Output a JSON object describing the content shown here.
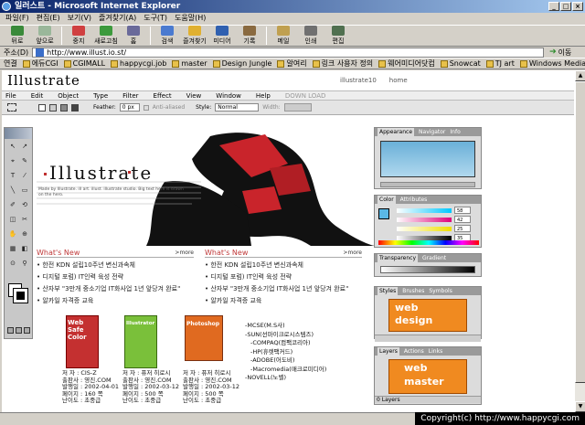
{
  "window": {
    "title": "일러스트 - Microsoft Internet Explorer"
  },
  "menu": [
    "파일(F)",
    "편집(E)",
    "보기(V)",
    "즐겨찾기(A)",
    "도구(T)",
    "도움말(H)"
  ],
  "toolbar": {
    "buttons": [
      {
        "label": "뒤로",
        "icon": "back-arrow-icon",
        "color": "#3a8a3a"
      },
      {
        "label": "앞으로",
        "icon": "forward-arrow-icon",
        "color": "#9ab79a"
      },
      {
        "label": "중지",
        "icon": "stop-icon",
        "color": "#d04040"
      },
      {
        "label": "새로고침",
        "icon": "refresh-icon",
        "color": "#3c9a3c"
      },
      {
        "label": "홈",
        "icon": "home-icon",
        "color": "#6a6a9a"
      },
      {
        "label": "검색",
        "icon": "search-icon",
        "color": "#4a7ad0"
      },
      {
        "label": "즐겨찾기",
        "icon": "favorites-icon",
        "color": "#e0b030"
      },
      {
        "label": "미디어",
        "icon": "media-icon",
        "color": "#3060b0"
      },
      {
        "label": "기록",
        "icon": "history-icon",
        "color": "#8a6a40"
      },
      {
        "label": "메일",
        "icon": "mail-icon",
        "color": "#c0a050"
      },
      {
        "label": "인쇄",
        "icon": "print-icon",
        "color": "#707070"
      },
      {
        "label": "편집",
        "icon": "edit-icon",
        "color": "#507050"
      }
    ]
  },
  "address": {
    "label": "주소(D)",
    "url": "http://www.illust.io.st/",
    "go_label": "이동"
  },
  "links": {
    "label": "연결",
    "items": [
      "에듀CGI",
      "CGIMALL",
      "happycgi.job",
      "master",
      "Design Jungle",
      "알여리",
      "링크 사용자 정의",
      "웨어미디어닷컴",
      "Snowcat",
      "TJ art",
      "Windows Media"
    ]
  },
  "site": {
    "logo": "Illustrate",
    "header_links": [
      "illustrate10",
      "home"
    ],
    "ai_menu": [
      "File",
      "Edit",
      "Object",
      "Type",
      "Filter",
      "Effect",
      "View",
      "Window",
      "Help"
    ],
    "ai_menu_disabled": "DOWN LOAD",
    "ai_controls": {
      "feather_label": "Feather:",
      "feather_value": "0 px",
      "anti_alias": "Anti-aliased",
      "style_label": "Style:",
      "style_value": "Normal",
      "width_label": "Width:"
    },
    "hero_logo": "Illustrate",
    "hero_text": "Made by Illustrate. ill art. illust. illustrate studio. Big text here is drawn on the hero.",
    "news_left": {
      "title": "What's New",
      "more": "more",
      "items": [
        "한전 KDN 설립10주년 변신과속체",
        "디지털 포럼) IT인력 육성 전략",
        "산자부 \"3만개 중소기업 IT화사업 1년 앞당겨 완료\"",
        "알카일 자격증 교육"
      ]
    },
    "news_right": {
      "title": "What's New",
      "more": "more",
      "items": [
        "한전 KDN 설립10주년 변신과속체",
        "디지털 포럼) IT인력 육성 전략",
        "산자부 \"3만개 중소기업 IT화사업 1년 앞당겨 완료\"",
        "알카일 자격증 교육"
      ]
    },
    "books": [
      {
        "cover_title": "Web Safe Color",
        "cover_color": "#c43030",
        "author": "저 자 : CIS-Z",
        "publisher": "출판사 : 영진.COM",
        "date": "발행일 : 2002-04-01",
        "pages": "페이지 : 160 쪽",
        "level": "난이도 : 초중급"
      },
      {
        "cover_title": "Illustrator",
        "cover_color": "#7ac03a",
        "author": "저 자 : 퓨저 히로시",
        "publisher": "출판사 : 영진.COM",
        "date": "발행일 : 2002-03-12",
        "pages": "페이지 : 500 쪽",
        "level": "난이도 : 초중급"
      },
      {
        "cover_title": "Photoshop",
        "cover_color": "#e06a20",
        "author": "저 자 : 퓨저 히로시",
        "publisher": "출판사 : 영진.COM",
        "date": "발행일 : 2002-03-12",
        "pages": "페이지 : 500 쪽",
        "level": "난이도 : 초중급"
      }
    ],
    "software": [
      "MCSE(M.S사)",
      "SUN(선마이크로시스템즈)",
      "COMPAQ(컴팩코리아)",
      "HP(휴렛팩커드)",
      "ADOBE(어도비)",
      "Macromedia(매크로미디어)",
      "NOVELL(노벨)"
    ],
    "panels": {
      "navigator_tabs": [
        "Appearance",
        "Navigator",
        "Info"
      ],
      "color_tabs": [
        "Color",
        "Attributes"
      ],
      "color_values": [
        "58",
        "42",
        "25",
        "35"
      ],
      "gradient_tabs": [
        "Transparency",
        "Gradient"
      ],
      "styles_tabs": [
        "Styles",
        "Brushes",
        "Symbols"
      ],
      "styles_banner": {
        "line1": "web",
        "line2": "design"
      },
      "layers_tabs": [
        "Layers",
        "Actions",
        "Links"
      ],
      "layers_banner": {
        "line1": "web",
        "line2": "master"
      },
      "layers_footer": "0 Layers"
    }
  },
  "copyright": "Copyright(c) http://www.happycgi.com"
}
